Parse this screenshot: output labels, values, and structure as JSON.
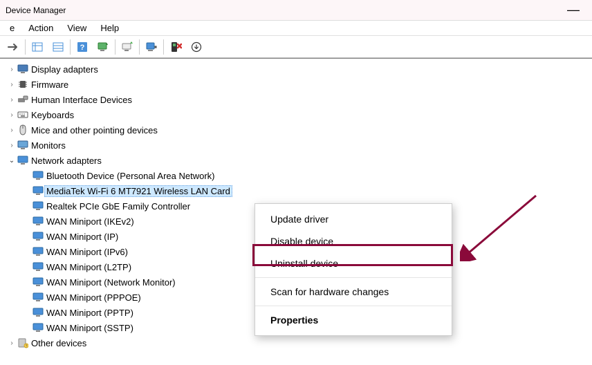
{
  "window": {
    "title": "Device Manager"
  },
  "menubar": {
    "file": "e",
    "action": "Action",
    "view": "View",
    "help": "Help"
  },
  "tree": {
    "display_adapters": "Display adapters",
    "firmware": "Firmware",
    "hid": "Human Interface Devices",
    "keyboards": "Keyboards",
    "mice": "Mice and other pointing devices",
    "monitors": "Monitors",
    "network_adapters": "Network adapters",
    "net_children": {
      "bt": "Bluetooth Device (Personal Area Network)",
      "mediatek": "MediaTek Wi-Fi 6 MT7921 Wireless LAN Card",
      "realtek": "Realtek PCIe GbE Family Controller",
      "wan_ikev2": "WAN Miniport (IKEv2)",
      "wan_ip": "WAN Miniport (IP)",
      "wan_ipv6": "WAN Miniport (IPv6)",
      "wan_l2tp": "WAN Miniport (L2TP)",
      "wan_nm": "WAN Miniport (Network Monitor)",
      "wan_pppoe": "WAN Miniport (PPPOE)",
      "wan_pptp": "WAN Miniport (PPTP)",
      "wan_sstp": "WAN Miniport (SSTP)"
    },
    "other_devices": "Other devices"
  },
  "contextmenu": {
    "update": "Update driver",
    "disable": "Disable device",
    "uninstall": "Uninstall device",
    "scan": "Scan for hardware changes",
    "properties": "Properties"
  }
}
